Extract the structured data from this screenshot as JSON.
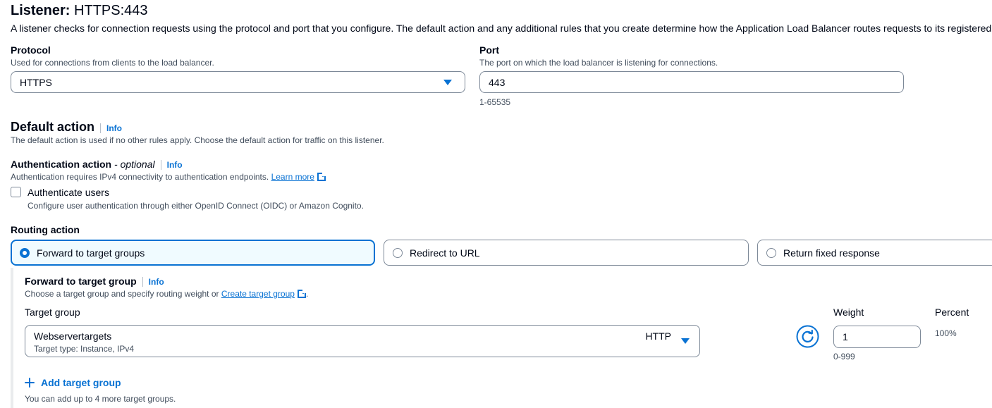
{
  "listener": {
    "title_prefix": "Listener:",
    "title_value": "HTTPS:443",
    "description": "A listener checks for connection requests using the protocol and port that you configure. The default action and any additional rules that you create determine how the Application Load Balancer routes requests to its registered targets."
  },
  "protocol": {
    "label": "Protocol",
    "description": "Used for connections from clients to the load balancer.",
    "value": "HTTPS"
  },
  "port": {
    "label": "Port",
    "description": "The port on which the load balancer is listening for connections.",
    "value": "443",
    "constraint": "1-65535"
  },
  "default_action": {
    "title": "Default action",
    "info": "Info",
    "description": "The default action is used if no other rules apply. Choose the default action for traffic on this listener."
  },
  "authentication": {
    "label": "Authentication action",
    "optional": "- optional",
    "info": "Info",
    "description": "Authentication requires IPv4 connectivity to authentication endpoints.",
    "learn_more": "Learn more",
    "checkbox_label": "Authenticate users",
    "checkbox_description": "Configure user authentication through either OpenID Connect (OIDC) or Amazon Cognito."
  },
  "routing": {
    "label": "Routing action",
    "options": [
      {
        "label": "Forward to target groups",
        "selected": true
      },
      {
        "label": "Redirect to URL",
        "selected": false
      },
      {
        "label": "Return fixed response",
        "selected": false
      }
    ]
  },
  "forward": {
    "title": "Forward to target group",
    "info": "Info",
    "description": "Choose a target group and specify routing weight or",
    "create_link": "Create target group",
    "description_end": ".",
    "target_group_label": "Target group",
    "target_group_name": "Webservertargets",
    "target_group_type": "Target type: Instance, IPv4",
    "target_group_protocol": "HTTP",
    "weight_label": "Weight",
    "weight_value": "1",
    "weight_constraint": "0-999",
    "percent_label": "Percent",
    "percent_value": "100%",
    "add_button": "Add target group",
    "add_note": "You can add up to 4 more target groups."
  },
  "colors": {
    "accent": "#0972d3",
    "text": "#000716",
    "muted": "#414d5c",
    "border": "#7d8998"
  },
  "icons": [
    "chevron-down-icon",
    "external-link-icon",
    "refresh-icon",
    "plus-icon"
  ]
}
